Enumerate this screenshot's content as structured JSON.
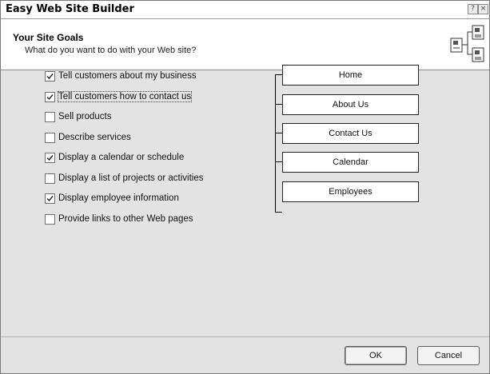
{
  "window": {
    "title": "Easy Web Site Builder",
    "help_glyph": "?",
    "close_glyph": "×"
  },
  "header": {
    "title": "Your Site Goals",
    "subtitle": "What do you want to do with your Web site?",
    "icon": "site-pages-icon"
  },
  "goals": [
    {
      "label": "Tell customers about my business",
      "checked": true
    },
    {
      "label": "Tell customers how to contact us",
      "checked": true,
      "focused": true
    },
    {
      "label": "Sell products",
      "checked": false
    },
    {
      "label": "Describe services",
      "checked": false
    },
    {
      "label": "Display a calendar or schedule",
      "checked": true
    },
    {
      "label": "Display a list of projects or activities",
      "checked": false
    },
    {
      "label": "Display employee information",
      "checked": true
    },
    {
      "label": "Provide links to other Web pages",
      "checked": false
    }
  ],
  "site_map": {
    "pages": [
      "Home",
      "About Us",
      "Contact Us",
      "Calendar",
      "Employees"
    ]
  },
  "buttons": {
    "ok": "OK",
    "cancel": "Cancel"
  }
}
